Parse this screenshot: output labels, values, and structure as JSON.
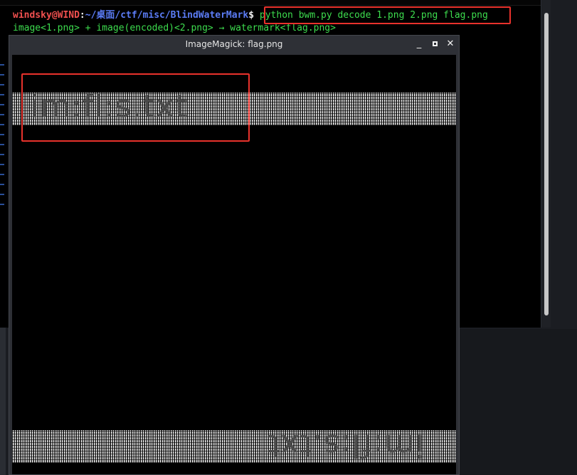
{
  "terminal": {
    "prompt_user": "windsky@WIND",
    "prompt_sep": ":",
    "prompt_path": "~/桌面/ctf/misc/BlindWaterMark",
    "prompt_dollar": "$",
    "command": "python bwm.py decode 1.png 2.png flag.png",
    "output": "image<1.png> + image(encoded)<2.png> → watermark<flag.png>"
  },
  "image_window": {
    "title": "ImageMagick: flag.png",
    "minimize_label": "_",
    "close_label": "✕"
  },
  "watermark": {
    "text": "im:fl:s.txt"
  },
  "colors": {
    "highlight": "#e8322c",
    "prompt_user": "#f0504f",
    "prompt_path": "#5b7cf5",
    "command": "#3ddc4e"
  }
}
